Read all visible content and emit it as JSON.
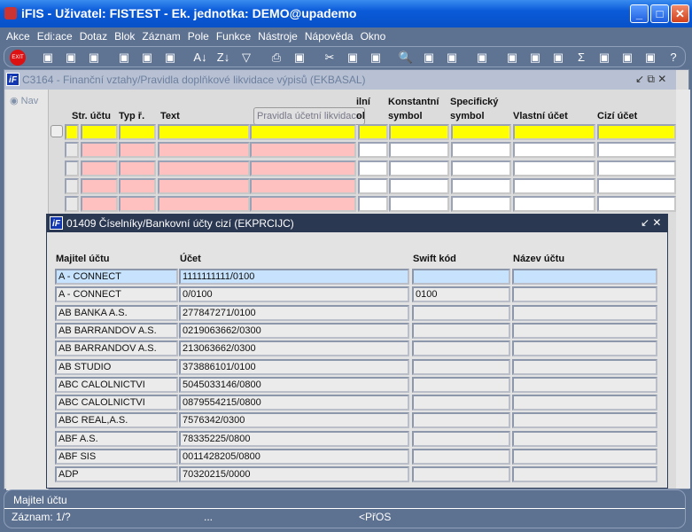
{
  "app": {
    "title": "iFIS - Uživatel: FISTEST - Ek. jednotka: DEMO@upademo"
  },
  "menu": [
    "Akce",
    "Edi:ace",
    "Dotaz",
    "Blok",
    "Záznam",
    "Pole",
    "Funkce",
    "Nástroje",
    "Nápověda",
    "Okno"
  ],
  "toolbar": {
    "icons": [
      "exit-icon",
      "insert-record-icon",
      "save-icon",
      "delete-record-icon",
      "query-enter-icon",
      "query-execute-icon",
      "query-cancel-icon",
      "sort-asc-icon",
      "sort-desc-icon",
      "filter-icon",
      "print-icon",
      "print-preview-icon",
      "cut-icon",
      "copy-icon",
      "paste-icon",
      "zoom-icon",
      "list-icon",
      "columns-icon",
      "properties-icon",
      "settings-icon",
      "tree-icon",
      "calendar-icon",
      "sum-icon",
      "excel-icon",
      "browser-icon",
      "help-context-icon",
      "help-icon"
    ],
    "exit_label": "EXIT"
  },
  "inner": {
    "title": "C3164 - Finanční vztahy/Pravidla doplňkové likvidace výpisů (EKBASAL)",
    "nav": "Nav",
    "headers": [
      "Str. účtu",
      "Typ ř.",
      "Text",
      "Pravidla účetní likvidace",
      "ilní\nol",
      "Konstantní\nsymbol",
      "Specifický\nsymbol",
      "Vlastní účet",
      "Cizí účet"
    ]
  },
  "modal": {
    "title": "01409   Číselníky/Bankovní účty cizí (EKPRCIJC)",
    "headers": [
      "Majitel účtu",
      "Účet",
      "Swift kód",
      "Název účtu"
    ],
    "rows": [
      [
        "A - CONNECT",
        "1111111111/0100",
        "",
        ""
      ],
      [
        "A - CONNECT",
        "0/0100",
        "0100",
        ""
      ],
      [
        "AB BANKA A.S.",
        "277847271/0100",
        "",
        ""
      ],
      [
        "AB BARRANDOV A.S.",
        "0219063662/0300",
        "",
        ""
      ],
      [
        "AB BARRANDOV A.S.",
        "213063662/0300",
        "",
        ""
      ],
      [
        "AB STUDIO",
        "373886101/0100",
        "",
        ""
      ],
      [
        "ABC CALOLNICTVI",
        "5045033146/0800",
        "",
        ""
      ],
      [
        "ABC CALOLNICTVI",
        "0879554215/0800",
        "",
        ""
      ],
      [
        "ABC REAL,A.S.",
        "7576342/0300",
        "",
        ""
      ],
      [
        "ABF A.S.",
        "78335225/0800",
        "",
        ""
      ],
      [
        "ABF SIS",
        "0011428205/0800",
        "",
        ""
      ],
      [
        "ADP",
        "70320215/0000",
        "",
        ""
      ]
    ]
  },
  "status": {
    "field": "Majitel účtu",
    "record": "Záznam: 1/?",
    "dots": "...",
    "mode": "<PřOS"
  },
  "colors": {
    "required": "#ffc0c0",
    "current": "#ffff00",
    "selected": "#c6e2fc"
  }
}
